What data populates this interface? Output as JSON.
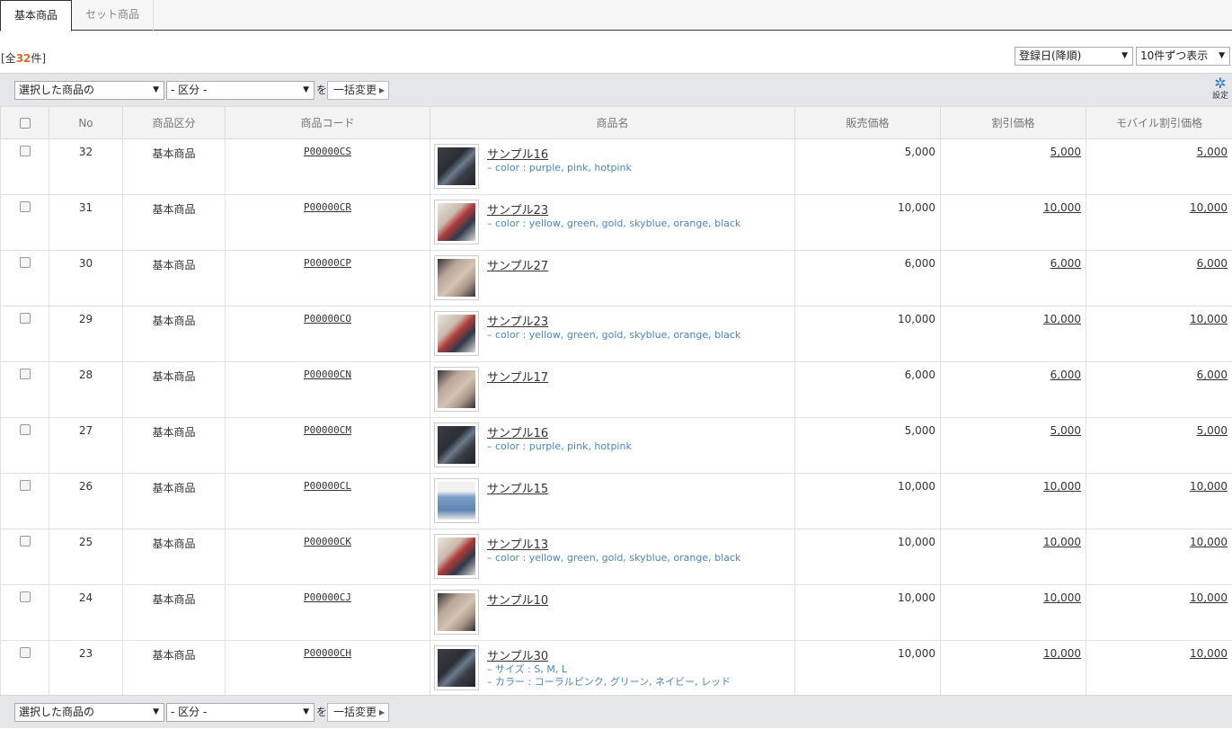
{
  "tabs": {
    "basic": "基本商品",
    "set": "セット商品"
  },
  "count": {
    "prefix": "[全",
    "number": "32",
    "suffix": "件]"
  },
  "sort": {
    "order": "登録日(降順)",
    "per_page": "10件ずつ表示"
  },
  "bulk": {
    "target": "選択した商品の",
    "field": "- 区分 -",
    "wo": "を",
    "button": "一括変更"
  },
  "settings_label": "設定",
  "headers": [
    "No",
    "商品区分",
    "商品コード",
    "商品名",
    "販売価格",
    "割引価格",
    "モバイル割引価格"
  ],
  "rows": [
    {
      "no": "32",
      "type": "基本商品",
      "code": "P00000CS",
      "name": "サンプル16",
      "options": [
        "– color : purple, pink, hotpink"
      ],
      "price": "5,000",
      "discount": "5,000",
      "mobile": "5,000",
      "img": "dark"
    },
    {
      "no": "31",
      "type": "基本商品",
      "code": "P00000CR",
      "name": "サンプル23",
      "options": [
        "– color : yellow, green, gold, skyblue, orange, black"
      ],
      "price": "10,000",
      "discount": "10,000",
      "mobile": "10,000",
      "img": "mixed"
    },
    {
      "no": "30",
      "type": "基本商品",
      "code": "P00000CP",
      "name": "サンプル27",
      "options": [],
      "price": "6,000",
      "discount": "6,000",
      "mobile": "6,000",
      "img": "beige"
    },
    {
      "no": "29",
      "type": "基本商品",
      "code": "P00000CO",
      "name": "サンプル23",
      "options": [
        "– color : yellow, green, gold, skyblue, orange, black"
      ],
      "price": "10,000",
      "discount": "10,000",
      "mobile": "10,000",
      "img": "mixed"
    },
    {
      "no": "28",
      "type": "基本商品",
      "code": "P00000CN",
      "name": "サンプル17",
      "options": [],
      "price": "6,000",
      "discount": "6,000",
      "mobile": "6,000",
      "img": "beige"
    },
    {
      "no": "27",
      "type": "基本商品",
      "code": "P00000CM",
      "name": "サンプル16",
      "options": [
        "– color : purple, pink, hotpink"
      ],
      "price": "5,000",
      "discount": "5,000",
      "mobile": "5,000",
      "img": "dark"
    },
    {
      "no": "26",
      "type": "基本商品",
      "code": "P00000CL",
      "name": "サンプル15",
      "options": [],
      "price": "10,000",
      "discount": "10,000",
      "mobile": "10,000",
      "img": "jeans"
    },
    {
      "no": "25",
      "type": "基本商品",
      "code": "P00000CK",
      "name": "サンプル13",
      "options": [
        "– color : yellow, green, gold, skyblue, orange, black"
      ],
      "price": "10,000",
      "discount": "10,000",
      "mobile": "10,000",
      "img": "mixed"
    },
    {
      "no": "24",
      "type": "基本商品",
      "code": "P00000CJ",
      "name": "サンプル10",
      "options": [],
      "price": "10,000",
      "discount": "10,000",
      "mobile": "10,000",
      "img": "beige"
    },
    {
      "no": "23",
      "type": "基本商品",
      "code": "P00000CH",
      "name": "サンプル30",
      "options": [
        "– サイズ : S, M, L",
        "– カラー : コーラルピンク, グリーン, ネイビー, レッド"
      ],
      "price": "10,000",
      "discount": "10,000",
      "mobile": "10,000",
      "img": "dark"
    }
  ],
  "colors": {
    "accent": "#e06a1c",
    "option_text": "#4a86c5",
    "settings_icon": "#2a7bd3",
    "bar_bg": "#e4e6ea"
  },
  "icons": {
    "settings": "gear-icon",
    "dropdown": "chevron-down-icon",
    "bulk_button": "caret-right-icon"
  }
}
